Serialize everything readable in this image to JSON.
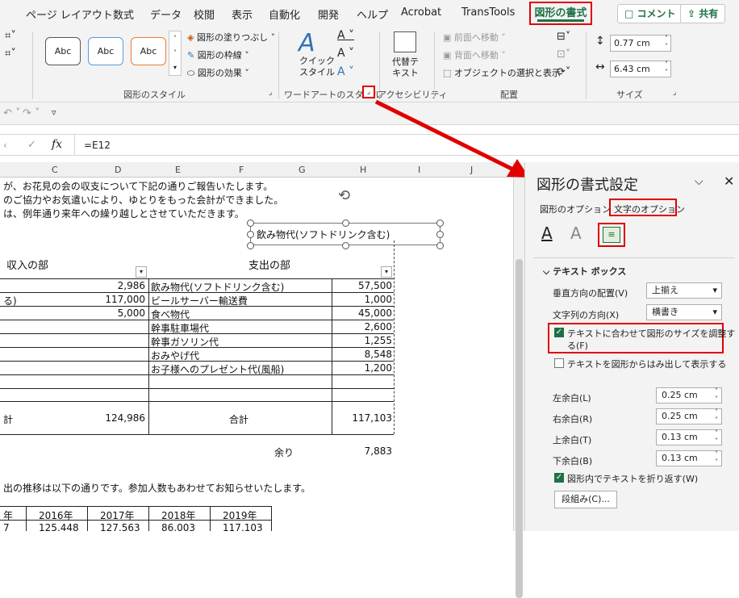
{
  "tabs": [
    "ページ レイアウト",
    "数式",
    "データ",
    "校閲",
    "表示",
    "自動化",
    "開発",
    "ヘルプ",
    "Acrobat",
    "TransTools"
  ],
  "active_tab": "図形の書式",
  "comment_btn": "コメント",
  "share_btn": "共有",
  "ribbon": {
    "style_samples": [
      "Abc",
      "Abc",
      "Abc"
    ],
    "fill": "図形の塗りつぶし",
    "outline": "図形の枠線",
    "effect": "図形の効果",
    "shape_styles_label": "図形のスタイル",
    "quick_style": "クイック\nスタイル",
    "wordart_label": "ワードアートのスタイル",
    "alt_text": "代替テ\nキスト",
    "accessibility_label": "アクセシビリティ",
    "bring_forward": "前面へ移動",
    "send_backward": "背面へ移動",
    "selection_pane": "オブジェクトの選択と表示",
    "arrange_label": "配置",
    "height": "0.77 cm",
    "width": "6.43 cm",
    "size_label": "サイズ"
  },
  "formula": "=E12",
  "columns": [
    "C",
    "D",
    "E",
    "F",
    "G",
    "H",
    "I",
    "J"
  ],
  "sheet": {
    "line1": "が、お花見の会の収支について下記の通りご報告いたします。",
    "line2": "のご協力やお気遣いにより、ゆとりをもった会計ができました。",
    "line3": "は、例年通り来年への繰り越しとさせていただきます。",
    "textbox": "飲み物代(ソフトドリンク含む)",
    "income_hdr": "収入の部",
    "expense_hdr": "支出の部",
    "rows": [
      {
        "b": "",
        "d": "2,986",
        "e": "飲み物代(ソフトドリンク含む)",
        "h": "57,500"
      },
      {
        "b": "る)",
        "d": "117,000",
        "e": "ビールサーバー輸送費",
        "h": "1,000"
      },
      {
        "b": "",
        "d": "5,000",
        "e": "食べ物代",
        "h": "45,000"
      },
      {
        "b": "",
        "d": "",
        "e": "幹事駐車場代",
        "h": "2,600"
      },
      {
        "b": "",
        "d": "",
        "e": "幹事ガソリン代",
        "h": "1,255"
      },
      {
        "b": "",
        "d": "",
        "e": "おみやげ代",
        "h": "8,548"
      },
      {
        "b": "",
        "d": "",
        "e": "お子様へのプレゼント代(風船)",
        "h": "1,200"
      }
    ],
    "total_left_tail": "計",
    "income_total": "124,986",
    "total_label": "合計",
    "expense_total": "117,103",
    "remainder_label": "余り",
    "remainder": "7,883",
    "trend_text": "出の推移は以下の通りです。参加人数もあわせてお知らせいたします。",
    "years": [
      "年",
      "2016年",
      "2017年",
      "2018年",
      "2019年"
    ],
    "year_vals": [
      "7",
      "125,448",
      "127,563",
      "86,003",
      "117,103"
    ]
  },
  "pane": {
    "title": "図形の書式設定",
    "tab1": "図形のオプション",
    "tab2": "文字のオプション",
    "section": "テキスト ボックス",
    "valign_label": "垂直方向の配置(V)",
    "valign": "上揃え",
    "dir_label": "文字列の方向(X)",
    "dir": "横書き",
    "autofit1": "テキストに合わせて図形のサイズを調整す",
    "autofit2": "る(F)",
    "overflow": "テキストを図形からはみ出して表示する",
    "left_label": "左余白(L)",
    "left": "0.25 cm",
    "right_label": "右余白(R)",
    "right": "0.25 cm",
    "top_label": "上余白(T)",
    "top": "0.13 cm",
    "bottom_label": "下余白(B)",
    "bottom": "0.13 cm",
    "wrap": "図形内でテキストを折り返す(W)",
    "columns_btn": "段組み(C)..."
  }
}
